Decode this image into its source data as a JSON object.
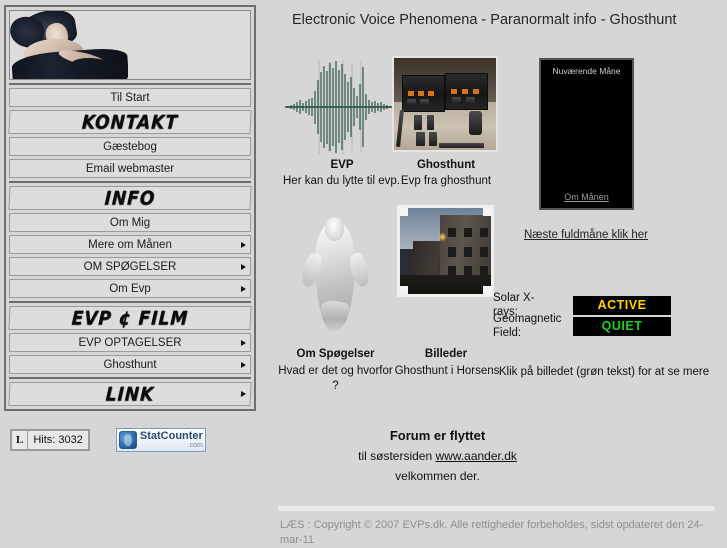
{
  "page": {
    "title": "Electronic Voice Phenomena - Paranormalt info - Ghosthunt",
    "background_color": "#d6d6d6"
  },
  "sidebar": {
    "banner_alt": "woman-banner-image",
    "groups": [
      {
        "items": [
          {
            "label": "Til Start",
            "style": "plain",
            "arrow": false
          },
          {
            "label": "KONTAKT",
            "style": "grunge",
            "arrow": false
          },
          {
            "label": "Gæstebog",
            "style": "plain",
            "arrow": false
          },
          {
            "label": "Email webmaster",
            "style": "plain",
            "arrow": false
          }
        ]
      },
      {
        "items": [
          {
            "label": "INFO",
            "style": "grunge",
            "arrow": false
          },
          {
            "label": "Om Mig",
            "style": "plain",
            "arrow": false
          },
          {
            "label": "Mere om Månen",
            "style": "plain",
            "arrow": true
          },
          {
            "label": "OM SPØGELSER",
            "style": "plain",
            "arrow": true
          },
          {
            "label": "Om Evp",
            "style": "plain",
            "arrow": true
          }
        ]
      },
      {
        "items": [
          {
            "label": "EVP ¢ FILM",
            "style": "grunge",
            "arrow": false
          },
          {
            "label": "EVP OPTAGELSER",
            "style": "plain",
            "arrow": true
          },
          {
            "label": "Ghosthunt",
            "style": "plain",
            "arrow": true
          }
        ]
      },
      {
        "items": [
          {
            "label": "LINK",
            "style": "grunge",
            "arrow": true
          }
        ]
      }
    ]
  },
  "counters": {
    "hit_prefix": "L",
    "hits_label": "Hits: 3032",
    "statcounter_name": "StatCounter",
    "statcounter_domain": ".com"
  },
  "cards": {
    "evp": {
      "image_name": "evp-waveform-image",
      "title": "EVP",
      "text": "Her kan du lytte til evp."
    },
    "ghosthunt": {
      "image_name": "ghosthunt-equipment-photo",
      "title": "Ghosthunt",
      "text": "Evp fra ghosthunt"
    },
    "spoegelser": {
      "image_name": "ghost-figure-image",
      "title": "Om Spøgelser",
      "text": "Hvad er det og hvorfor ?"
    },
    "billeder": {
      "image_name": "horsens-building-photo",
      "title": "Billeder",
      "text": "Ghosthunt i Horsens"
    }
  },
  "moon": {
    "panel_label": "Nuværende Måne",
    "panel_link": "Om Månen",
    "next_fullmoon_link": "Næste fuldmåne klik her"
  },
  "space_weather": {
    "solar": {
      "label": "Solar X-rays:",
      "status": "ACTIVE",
      "status_color": "#ffd400"
    },
    "geomagnetic": {
      "label_line1": "Geomagnetic",
      "label_line2": "Field:",
      "status": "QUIET",
      "status_color": "#22cc22"
    }
  },
  "klik_note": "Klik på billedet (grøn tekst) for at se mere",
  "forum": {
    "title": "Forum er flyttet",
    "line_prefix": "til søstersiden ",
    "link": "www.aander.dk",
    "welcome": "velkommen der."
  },
  "footer": {
    "text": "LÆS : Copyright © 2007 EVPs.dk. Alle rettigheder forbeholdes, sidst opdateret den 24-mar-11"
  }
}
